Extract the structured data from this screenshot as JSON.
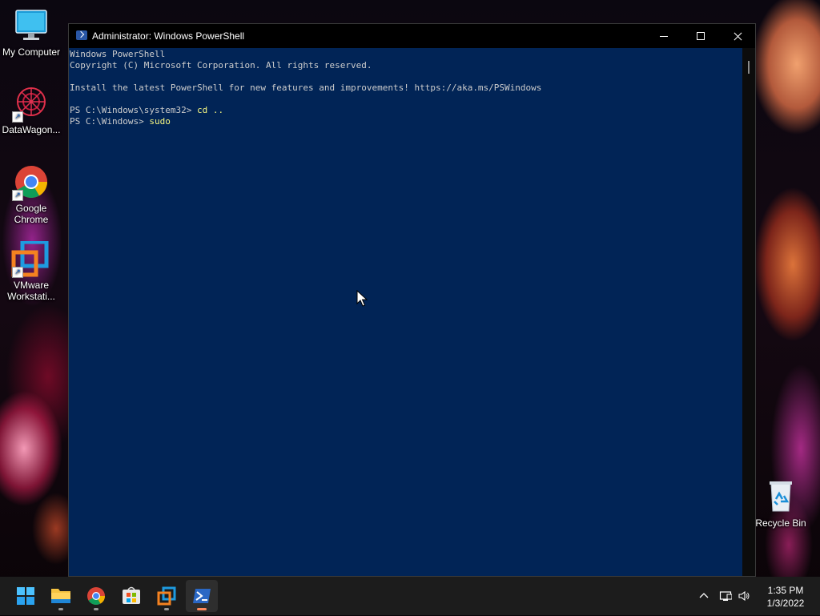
{
  "desktop": {
    "icons": [
      {
        "label": "My Computer",
        "icon": "monitor-icon"
      },
      {
        "label": "DataWagon...",
        "icon": "datawagon-icon"
      },
      {
        "label": "Google Chrome",
        "icon": "chrome-icon"
      },
      {
        "label": "VMware Workstati...",
        "icon": "vmware-icon"
      },
      {
        "label": "Recycle Bin",
        "icon": "recycle-bin-icon"
      }
    ]
  },
  "window": {
    "title": "Administrator: Windows PowerShell",
    "background_color": "#012456",
    "console": {
      "lines": [
        {
          "text": "Windows PowerShell"
        },
        {
          "text": "Copyright (C) Microsoft Corporation. All rights reserved."
        },
        {
          "text": ""
        },
        {
          "text": "Install the latest PowerShell for new features and improvements! https://aka.ms/PSWindows"
        },
        {
          "text": ""
        },
        {
          "prompt": "PS C:\\Windows\\system32> ",
          "command": "cd .."
        },
        {
          "prompt": "PS C:\\Windows> ",
          "command": "sudo"
        }
      ]
    }
  },
  "taskbar": {
    "apps": [
      {
        "name": "Start",
        "icon": "windows-start-icon"
      },
      {
        "name": "File Explorer",
        "icon": "folder-icon"
      },
      {
        "name": "Google Chrome",
        "icon": "chrome-icon"
      },
      {
        "name": "Microsoft Store",
        "icon": "store-icon"
      },
      {
        "name": "VMware Workstation",
        "icon": "vmware-icon"
      },
      {
        "name": "Windows PowerShell",
        "icon": "powershell-icon",
        "active": true
      }
    ],
    "tray": {
      "icons": [
        "chevron-up-icon",
        "network-icon",
        "volume-icon"
      ],
      "time": "1:35 PM",
      "date": "1/3/2022"
    }
  }
}
